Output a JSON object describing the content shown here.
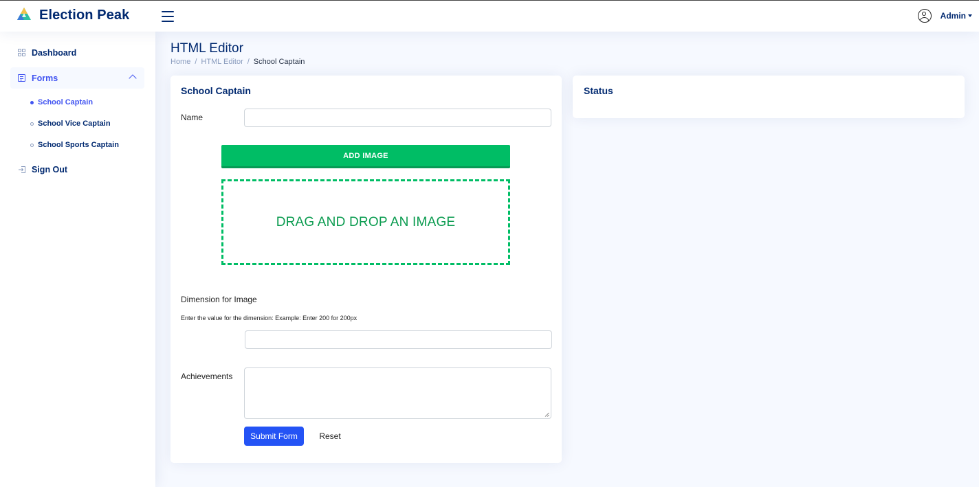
{
  "brand": {
    "name": "Election Peak",
    "icon": "logo-icon"
  },
  "header": {
    "menu_icon": "hamburger-icon",
    "user_icon": "user-circle-icon",
    "user_name": "Admin"
  },
  "sidebar": {
    "items": [
      {
        "label": "Dashboard",
        "icon": "grid-icon"
      },
      {
        "label": "Forms",
        "icon": "form-doc-icon",
        "expanded": true
      },
      {
        "label": "Sign Out",
        "icon": "sign-out-icon"
      }
    ],
    "forms_children": [
      {
        "label": "School Captain",
        "active": true
      },
      {
        "label": "School Vice Captain",
        "active": false
      },
      {
        "label": "School Sports Captain",
        "active": false
      }
    ]
  },
  "page": {
    "title": "HTML Editor",
    "breadcrumb": [
      "Home",
      "HTML Editor",
      "School Captain"
    ]
  },
  "form_card": {
    "title": "School Captain",
    "name_label": "Name",
    "name_value": "",
    "add_image_label": "ADD IMAGE",
    "drop_zone_text": "DRAG AND DROP AN IMAGE",
    "dimension_label": "Dimension for Image",
    "dimension_hint": "Enter the value for the dimension: Example: Enter 200 for 200px",
    "dimension_value": "",
    "achievements_label": "Achievements",
    "achievements_value": "",
    "submit_label": "Submit Form",
    "reset_label": "Reset"
  },
  "status_card": {
    "title": "Status"
  },
  "colors": {
    "primary": "#4154f1",
    "navy": "#012970",
    "green": "#00bd65",
    "submit_blue": "#2453f5",
    "background": "#f6f9ff"
  }
}
